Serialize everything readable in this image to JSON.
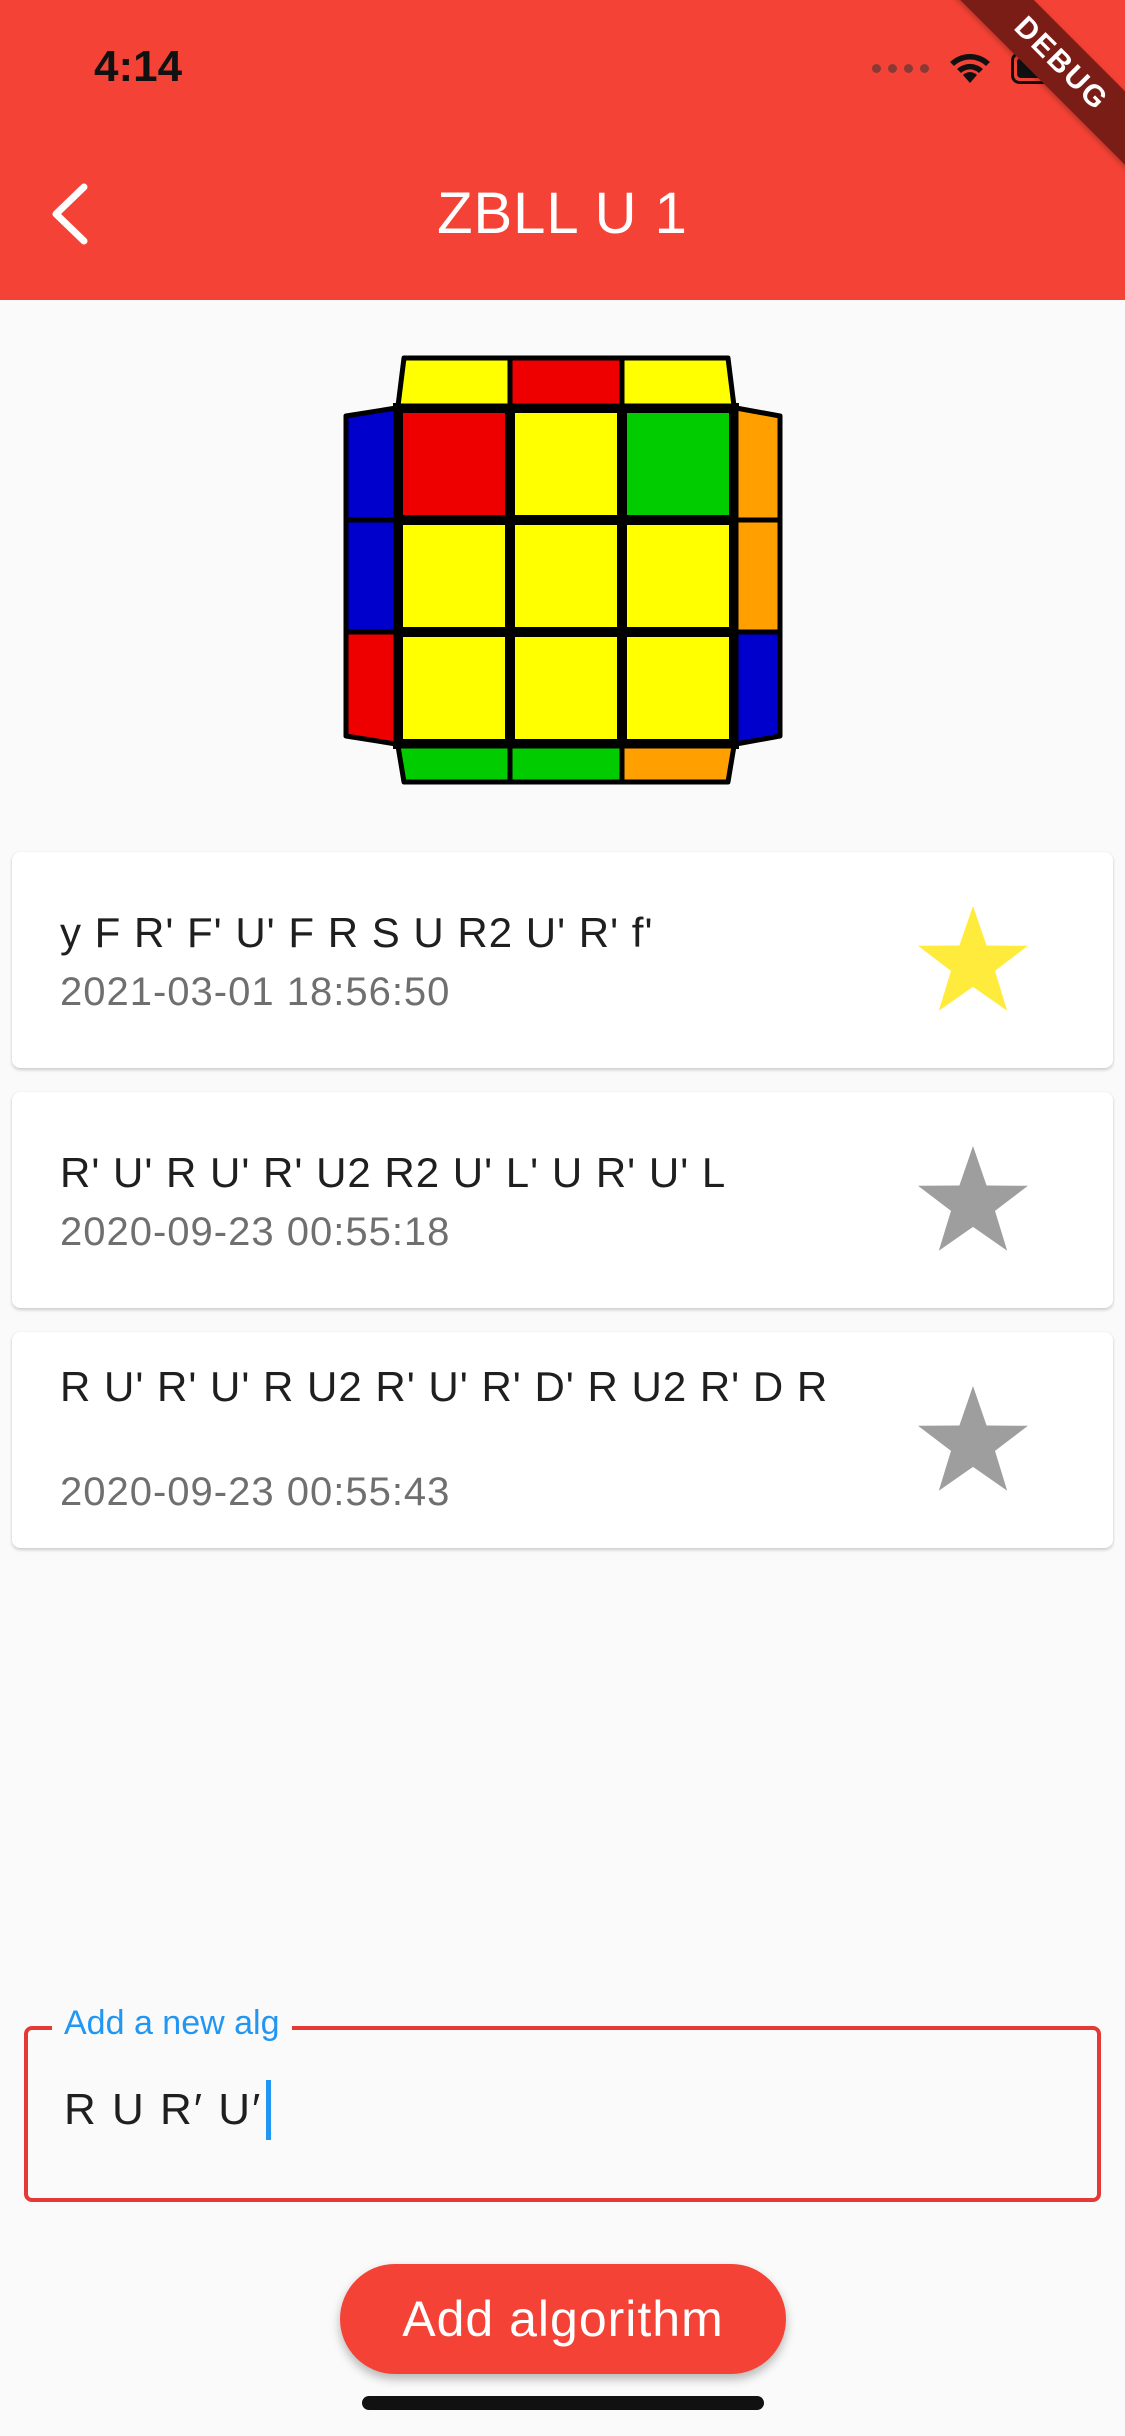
{
  "status_bar": {
    "time": "4:14",
    "debug_banner": "DEBUG"
  },
  "header": {
    "title": "ZBLL U 1",
    "back_icon": "chevron-left-icon",
    "color": "#f44336"
  },
  "cube": {
    "top_edge": [
      "#ffff00",
      "#ee0000",
      "#ffff00"
    ],
    "left_edge": [
      "#0000cc",
      "#0000cc",
      "#ee0000"
    ],
    "right_edge": [
      "#ffa000",
      "#ffa000",
      "#0000cc"
    ],
    "bottom_edge": [
      "#00cc00",
      "#00cc00",
      "#ffa000"
    ],
    "face": [
      [
        "#ee0000",
        "#ffff00",
        "#00cc00"
      ],
      [
        "#ffff00",
        "#ffff00",
        "#ffff00"
      ],
      [
        "#ffff00",
        "#ffff00",
        "#ffff00"
      ]
    ]
  },
  "algorithms": [
    {
      "alg": "y F R' F' U' F R S U R2 U' R' f'",
      "date": "2021-03-01 18:56:50",
      "favorite": true
    },
    {
      "alg": "R' U' R U' R' U2 R2 U' L' U R' U' L",
      "date": "2020-09-23 00:55:18",
      "favorite": false
    },
    {
      "alg": "R U' R' U' R U2 R' U' R' D' R U2 R' D R",
      "date": "2020-09-23 00:55:43",
      "favorite": false
    }
  ],
  "star_colors": {
    "favorite": "#ffeb3b",
    "default": "#9e9e9e"
  },
  "new_alg": {
    "label": "Add a new alg",
    "value": "R U R′ U′"
  },
  "add_button": {
    "label": "Add algorithm"
  }
}
